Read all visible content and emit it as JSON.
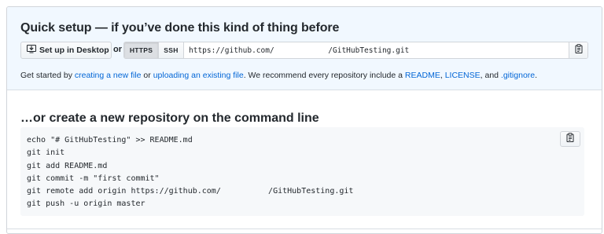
{
  "quick_setup": {
    "title": "Quick setup — if you’ve done this kind of thing before",
    "desktop_button": "Set up in Desktop",
    "or_label": "or",
    "protocols": [
      "HTTPS",
      "SSH"
    ],
    "selected_protocol": "HTTPS",
    "clone_url": "https://github.com/            /GitHubTesting.git",
    "hint": {
      "prefix": "Get started by ",
      "link_new_file": "creating a new file",
      "middle1": " or ",
      "link_upload": "uploading an existing file",
      "middle2": ". We recommend every repository include a ",
      "link_readme": "README",
      "sep1": ", ",
      "link_license": "LICENSE",
      "sep2": ", and ",
      "link_gitignore": ".gitignore",
      "suffix": "."
    }
  },
  "command_line": {
    "title": "…or create a new repository on the command line",
    "lines": [
      "echo \"# GitHubTesting\" >> README.md",
      "git init",
      "git add README.md",
      "git commit -m \"first commit\"",
      "git remote add origin https://github.com/          /GitHubTesting.git",
      "git push -u origin master"
    ]
  },
  "icons": {
    "desktop": "desktop-download-icon",
    "clipboard": "clipboard-icon"
  },
  "colors": {
    "link": "#0366d6",
    "quick_bg": "#f1f8ff",
    "code_bg": "#f6f8fa",
    "text": "#24292e"
  }
}
